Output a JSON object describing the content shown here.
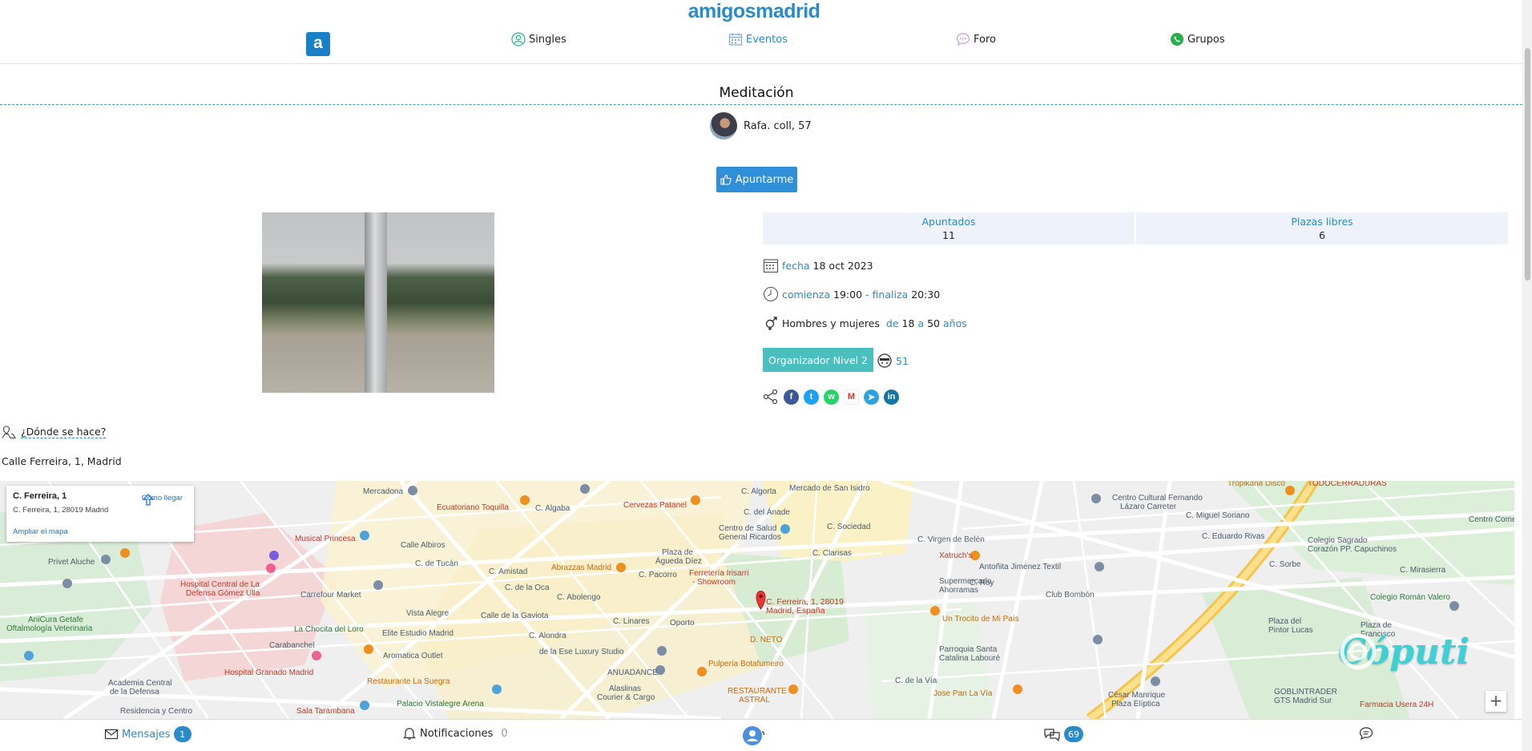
{
  "header": {
    "brand": "amigosmadrid",
    "logo_letter": "a",
    "nav": [
      {
        "label": "Singles"
      },
      {
        "label": "Eventos"
      },
      {
        "label": "Foro"
      },
      {
        "label": "Grupos"
      }
    ]
  },
  "event": {
    "title": "Meditación",
    "organizer": "Rafa. coll, 57",
    "join_label": "Apuntarme",
    "stats": [
      {
        "label": "Apuntados",
        "value": "11"
      },
      {
        "label": "Plazas libres",
        "value": "6"
      }
    ],
    "date_label": "fecha",
    "date": "18 oct 2023",
    "start_label": "comienza",
    "start": "19:00",
    "dash": "-",
    "end_label": "finaliza",
    "end": "20:30",
    "audience": "Hombres y mujeres",
    "age_from_label": "de",
    "age_from": "18",
    "age_to_label": "a",
    "age_to": "50",
    "age_unit": "años",
    "organizer_level": "Organizador Nivel 2",
    "karma": "51",
    "where_label": "¿Dónde se hace?",
    "address": "Calle Ferreira, 1, Madrid"
  },
  "map": {
    "card_title": "C. Ferreira, 1",
    "card_address": "C. Ferreira, 1, 28019 Madrid",
    "card_directions": "Cómo llegar",
    "card_expand": "Ampliar el mapa",
    "pin_label_1": "C. Ferreira, 1, 28019",
    "pin_label_2": "Madrid, España",
    "zoom_in": "+",
    "watermark": "Cóputi",
    "labels": {
      "mercadona": "Mercadona",
      "algorta": "C. Algorta",
      "msi": "Mercado de San Isidro",
      "ccf1": "Centro Cultural Fernando",
      "ccf2": "Lázaro Carreter",
      "tropikana": "Tropikana Disco",
      "todocerraduras": "TODOCERRADURAS",
      "ecuatoriano": "Ecuatoriano Toquilla",
      "algaba": "C. Algaba",
      "cervezas": "Cervezas Patanel",
      "anade": "C. del Ánade",
      "centro_salud1": "Centro de Salud",
      "centro_salud2": "General Ricardos",
      "sociedad": "C. Sociedad",
      "virgen": "C. Virgen de Belén",
      "miguel": "C. Miguel Soriano",
      "comercial": "Centro Comercial",
      "eduardo": "C. Eduardo Rivas",
      "colegio1": "Colegio Sagrado",
      "colegio2": "Corazón PP. Capuchinos",
      "musical": "Musical Princesa",
      "albiros": "Calle Albiros",
      "tucan": "C. de Tucán",
      "amistad": "C. Amistad",
      "abrazzas": "Abrazzas Madrid",
      "pacorro": "C. Pacorro",
      "plaza1": "Plaza de",
      "plaza2": "Águeda Díez",
      "clarisas": "C. Clarisas",
      "xatruch": "Xatruch's",
      "antonita": "Antoñita Jiménez Textil",
      "sorbe": "C. Sorbe",
      "mirasierra": "C. Mirasierra",
      "privet": "Privet Aluche",
      "hospital1": "Hospital Central de La",
      "hospital2": "Defensa Gómez Ulla",
      "carrefour": "Carrefour Market",
      "oca": "C. de la Oca",
      "abolengo": "C. Abolengo",
      "ferreteria1": "Ferretería Irisarri",
      "ferreteria2": "- Showroom",
      "supermercado1": "Supermercado",
      "supermercado2": "Ahorramas",
      "roy": "C. Roy",
      "bombon": "Club Bombón",
      "roman": "Colegio Román Valero",
      "vista": "Vista Alegre",
      "gaviota": "Calle de la Gaviota",
      "linares": "C. Linares",
      "oporto": "Oporto",
      "trocito": "Un Trocito de Mi País",
      "pinto1": "Plaza del",
      "pinto2": "Pintor Lucas",
      "plaza_fr1": "Plaza de",
      "plaza_fr2": "Francisco",
      "anicura1": "AniCura Getafe",
      "anicura2": "Oftalmología Veterinaria",
      "chocita": "La Chocita del Loro",
      "elite": "Elite Estudio Madrid",
      "alondra": "C. Alondra",
      "carabanchel": "Carabanchel",
      "aromatica": "Aromatica Outlet",
      "luxury": "de la Ese Luxury Studio",
      "neto": "D. NETO",
      "parroquia1": "Parroquia Santa",
      "parroquia2": "Catalina Labouré",
      "granado": "Hospital Granado Madrid",
      "suegra": "Restaurante La Suegra",
      "anuadance": "ANUADANCE",
      "pulperia": "Pulpería Botafumeiro",
      "via": "C. de la Vía",
      "cesar1": "César Manrique",
      "cesar2": "Plaza Elíptica",
      "goblin1": "GOBLINTRADER",
      "goblin2": "GTS Madrid Sur",
      "academia1": "Academia Central",
      "academia2": "de la Defensa",
      "vistalegre": "Palacio Vistalegre Arena",
      "alaslinas1": "Alaslinas",
      "alaslinas2": "Courier & Cargo",
      "astral1": "RESTAURANTE",
      "astral2": "ASTRAL",
      "jose": "Jose Pan La Vía",
      "farmacia": "Farmacia Usera 24H",
      "residencia": "Residencia y Centro",
      "sala": "Sala Tarambana",
      "ferreira": "C. Ferreira",
      "pan": "Pan"
    }
  },
  "bottom": {
    "messages_label": "Mensajes",
    "messages_count": "1",
    "notifications_label": "Notificaciones",
    "notifications_count": "0",
    "chat_count": "69"
  },
  "colors": {
    "accent": "#2a8bc8",
    "teal": "#49bfc0",
    "join": "#2f8fd8"
  }
}
